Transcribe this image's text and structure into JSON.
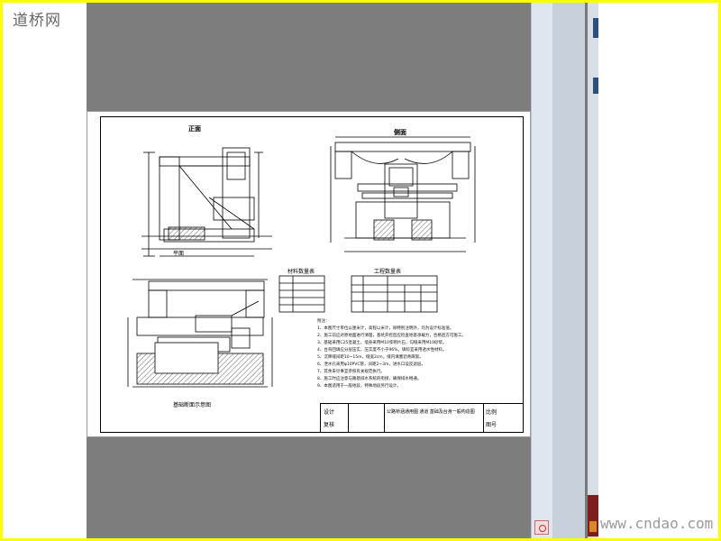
{
  "watermarks": {
    "top_left": "道桥网",
    "bottom_right": "www.cndao.com"
  },
  "drawing": {
    "view_front": "正面",
    "view_side": "侧面",
    "view_plan": "平面",
    "section_label": "基础断面示意图",
    "table1_title": "材料数量表",
    "table2_title": "工程数量表",
    "notes_title": "附注：",
    "notes": [
      "1、本图尺寸单位以厘米计，高程以米计，除特别注明外，均为设计标准值。",
      "2、施工前应对原地面进行清理，基坑开挖后应检查地基承载力，合格后方可施工。",
      "3、基础采用C25混凝土，墙身采用M10浆砌片石，勾缝采用M10砂浆。",
      "4、台背回填应分层压实，压实度不小于96%，填料宜采用透水性材料。",
      "5、沉降缝间距10~15m，缝宽2cm，缝内填塞沥青麻絮。",
      "6、泄水孔采用φ10PVC管，间距2~3m，进水口设反滤层。",
      "7、其余未尽事宜参照有关规范执行。",
      "8、施工时应注意与路基排水系统的衔接，确保排水畅通。",
      "9、本图适用于一般地段，特殊地段另行设计。"
    ],
    "title_block": {
      "design": "设计",
      "check": "复核",
      "drawing_title": "公路桥涵通用图 通道 基础及台身一般构造图",
      "scale": "比例",
      "sheet": "图号"
    }
  },
  "colors": {
    "border": "#ffff00",
    "viewer_bg": "#7d7d7d",
    "scrollbar": "#dfe6ef"
  }
}
